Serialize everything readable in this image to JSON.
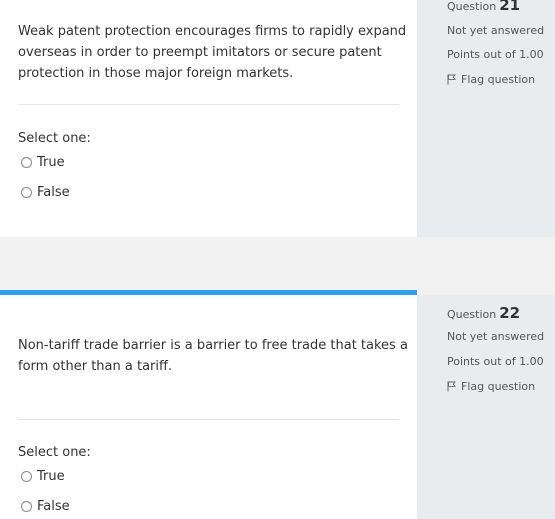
{
  "questions": [
    {
      "label": "Question",
      "number": "21",
      "status": "Not yet answered",
      "points": "Points out of 1.00",
      "flag_label": "Flag question",
      "text": "Weak patent protection encourages firms to rapidly expand overseas in order to preempt imitators or secure patent protection in those major foreign markets.",
      "select_label": "Select one:",
      "options": [
        "True",
        "False"
      ]
    },
    {
      "label": "Question",
      "number": "22",
      "status": "Not yet answered",
      "points": "Points out of 1.00",
      "flag_label": "Flag question",
      "text": "Non-tariff trade barrier is a barrier to free trade that takes a form other than a tariff.",
      "select_label": "Select one:",
      "options": [
        "True",
        "False"
      ]
    }
  ],
  "accent_color": "#2ea3f2"
}
